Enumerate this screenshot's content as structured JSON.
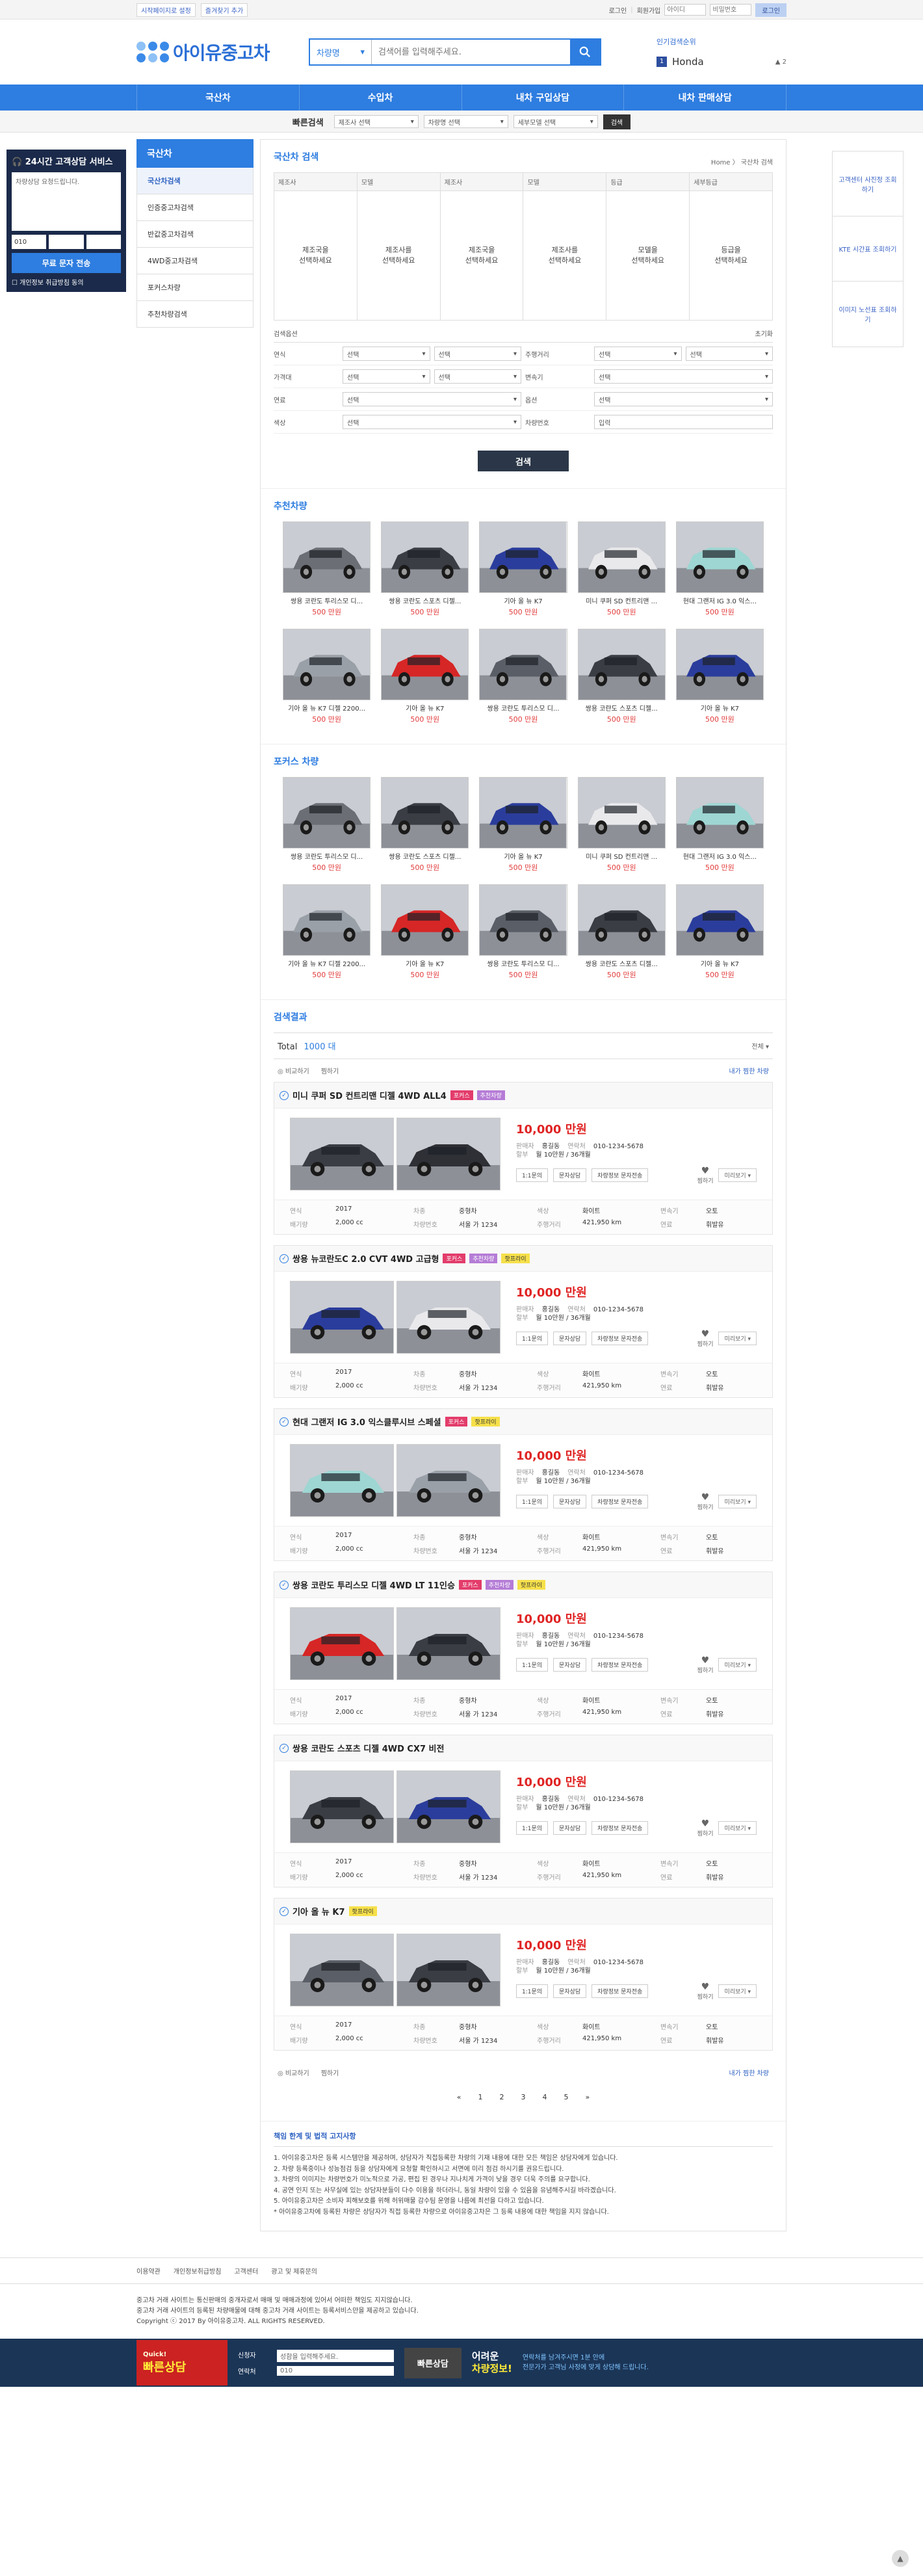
{
  "topbar": {
    "left": [
      "시작페이지로 설정",
      "즐겨찾기 추가"
    ],
    "right": [
      "로그인",
      "회원가입"
    ],
    "id_placeholder": "아이디",
    "pw_placeholder": "비밀번호",
    "login_btn": "로그인"
  },
  "header": {
    "logo": "아이유중고차",
    "search_select": "차량명",
    "search_placeholder": "검색어를 입력해주세요.",
    "rank_title": "인기검색순위",
    "rank_num": "1",
    "rank_value": "Honda",
    "rank_change": "▲ 2"
  },
  "nav": [
    "국산차",
    "수입차",
    "내차 구입상담",
    "내차 판매상담"
  ],
  "quick": {
    "label": "빠른검색",
    "selects": [
      "제조사 선택",
      "차량명 선택",
      "세부모델 선택"
    ],
    "button": "검색"
  },
  "leftcs": {
    "title": "24시간 고객상담 서비스",
    "placeholder": "차량상담 요청드립니다.",
    "phone_prefix": "010",
    "send": "무료 문자 전송",
    "agree": "개인정보 취급방침 동의"
  },
  "rightfloat": [
    "고객센터 사진정 조회하기",
    "KTE 시간표 조회하기",
    "이미지 노선표 조회하기"
  ],
  "sidebar": {
    "title": "국산차",
    "items": [
      "국산차검색",
      "인증중고차검색",
      "반값중고차검색",
      "4WD중고차검색",
      "포커스차량",
      "추천차량검색"
    ]
  },
  "domestic": {
    "title": "국산차 검색",
    "breadcrumb": "Home  〉 국산차 검색",
    "cols": [
      {
        "h": "제조사",
        "b": "제조국을\n선택하세요"
      },
      {
        "h": "모델",
        "b": "제조사를\n선택하세요"
      },
      {
        "h": "제조사",
        "b": "제조국을\n선택하세요"
      },
      {
        "h": "모델",
        "b": "제조사를\n선택하세요"
      },
      {
        "h": "등급",
        "b": "모델을\n선택하세요"
      },
      {
        "h": "세부등급",
        "b": "등급을\n선택하세요"
      }
    ],
    "options_title": "검색옵션",
    "reset": "초기화",
    "rows": [
      {
        "l1": "연식",
        "c1": [
          "선택",
          "선택"
        ],
        "l2": "주행거리",
        "c2": [
          "선택",
          "선택"
        ]
      },
      {
        "l1": "가격대",
        "c1": [
          "선택",
          "선택"
        ],
        "l2": "변속기",
        "c2": [
          "선택"
        ]
      },
      {
        "l1": "연료",
        "c1": [
          "선택"
        ],
        "l2": "옵션",
        "c2": [
          "선택"
        ]
      },
      {
        "l1": "색상",
        "c1": [
          "선택"
        ],
        "l2": "차량번호",
        "c2": [
          "입력"
        ]
      }
    ],
    "search_btn": "검색"
  },
  "recommended": {
    "title": "추천차량",
    "cars": [
      {
        "name": "쌍용 코란도 투리스모 디...",
        "price": "500 만원",
        "color": "#6b6e74"
      },
      {
        "name": "쌍용 코란도 스포츠 디젤...",
        "price": "500 만원",
        "color": "#3a3d44"
      },
      {
        "name": "기아 올 뉴 K7",
        "price": "500 만원",
        "color": "#2b3d9c"
      },
      {
        "name": "미니 쿠퍼 SD 컨트리맨 ...",
        "price": "500 만원",
        "color": "#e9e9ec"
      },
      {
        "name": "현대 그랜저 IG 3.0 익스...",
        "price": "500 만원",
        "color": "#9ed6d3"
      },
      {
        "name": "기아 올 뉴 K7 디젤 2200...",
        "price": "500 만원",
        "color": "#9aa0a8"
      },
      {
        "name": "기아 올 뉴 K7",
        "price": "500 만원",
        "color": "#d62626"
      },
      {
        "name": "쌍용 코란도 투리스모 디...",
        "price": "500 만원",
        "color": "#5a5e66"
      },
      {
        "name": "쌍용 코란도 스포츠 디젤...",
        "price": "500 만원",
        "color": "#3a3d44"
      },
      {
        "name": "기아 올 뉴 K7",
        "price": "500 만원",
        "color": "#2b3d9c"
      }
    ]
  },
  "focus": {
    "title": "포커스 차량",
    "cars": [
      {
        "name": "쌍용 코란도 투리스모 디...",
        "price": "500 만원",
        "color": "#6b6e74"
      },
      {
        "name": "쌍용 코란도 스포츠 디젤...",
        "price": "500 만원",
        "color": "#3a3d44"
      },
      {
        "name": "기아 올 뉴 K7",
        "price": "500 만원",
        "color": "#2b3d9c"
      },
      {
        "name": "미니 쿠퍼 SD 컨트리맨 ...",
        "price": "500 만원",
        "color": "#e9e9ec"
      },
      {
        "name": "현대 그랜저 IG 3.0 익스...",
        "price": "500 만원",
        "color": "#9ed6d3"
      },
      {
        "name": "기아 올 뉴 K7 디젤 2200...",
        "price": "500 만원",
        "color": "#9aa0a8"
      },
      {
        "name": "기아 올 뉴 K7",
        "price": "500 만원",
        "color": "#d62626"
      },
      {
        "name": "쌍용 코란도 투리스모 디...",
        "price": "500 만원",
        "color": "#5a5e66"
      },
      {
        "name": "쌍용 코란도 스포츠 디젤...",
        "price": "500 만원",
        "color": "#3a3d44"
      },
      {
        "name": "기아 올 뉴 K7",
        "price": "500 만원",
        "color": "#2b3d9c"
      }
    ]
  },
  "results": {
    "title": "검색결과",
    "total_label": "Total",
    "total_value": "1000 대",
    "sort": "전체",
    "tools_left": [
      "비교하기",
      "찜하기"
    ],
    "tools_right": "내가 찜한 차량",
    "labels": {
      "seller": "판매자",
      "seller_v": "홍길동",
      "phone": "연락처",
      "phone_v": "010-1234-5678",
      "installment": "할부",
      "installment_v": "월 10만원 / 36개월",
      "act1": "1:1문의",
      "act2": "문자상담",
      "act3": "차량정보 문자전송",
      "heart": "찜하기",
      "more": "미리보기",
      "year": "연식",
      "year_v": "2017",
      "kind": "차종",
      "kind_v": "중형차",
      "color": "색상",
      "color_v": "화이트",
      "trans": "변속기",
      "trans_v": "오토",
      "cc": "배기량",
      "cc_v": "2,000 cc",
      "plate": "차량번호",
      "plate_v": "서울 가 1234",
      "km": "주행거리",
      "km_v": "421,950 km",
      "fuel": "연료",
      "fuel_v": "휘발유"
    },
    "items": [
      {
        "name": "미니 쿠퍼 SD 컨트리맨 디젤 4WD ALL4",
        "badges": [
          "포커스",
          "추천차량"
        ],
        "price": "10,000 만원",
        "c1": "#3a3d44",
        "c2": "#2e3036"
      },
      {
        "name": "쌍용 뉴코란도C 2.0 CVT 4WD 고급형",
        "badges": [
          "포커스",
          "추천차량",
          "핫프라이"
        ],
        "price": "10,000 만원",
        "c1": "#2b3d9c",
        "c2": "#e9e9ec"
      },
      {
        "name": "현대 그랜저 IG 3.0 익스클루시브 스페셜",
        "badges": [
          "포커스",
          "핫프라이"
        ],
        "price": "10,000 만원",
        "c1": "#9ed6d3",
        "c2": "#9aa0a8"
      },
      {
        "name": "쌍용 코란도 투리스모 디젤 4WD LT 11인승",
        "badges": [
          "포커스",
          "추천차량",
          "핫프라이"
        ],
        "price": "10,000 만원",
        "c1": "#d62626",
        "c2": "#3a3d44"
      },
      {
        "name": "쌍용 코란도 스포츠 디젤 4WD CX7 비전",
        "badges": [],
        "price": "10,000 만원",
        "c1": "#3a3d44",
        "c2": "#2b3d9c"
      },
      {
        "name": "기아 올 뉴 K7",
        "badges": [
          "핫프라이"
        ],
        "price": "10,000 만원",
        "c1": "#5a5e66",
        "c2": "#3a3d44"
      }
    ],
    "pager": [
      "«",
      "1",
      "2",
      "3",
      "4",
      "5",
      "»"
    ]
  },
  "notice": {
    "title": "책임 한계 및 법적 고지사항",
    "lines": [
      "1. 아이유중고차은 등록 시스템만을 제공하며, 상담자가 직접등록한 차량의 기재 내용에 대한 모든 책임은 상담자에게 있습니다.",
      "2. 차량 등록중이나 성능점검 등을 상담자에게 요청할 확인하시고 서면에 미리 점검 하시기를 권유드립니다.",
      "3. 차량의 이미지는 차량번호가 미노적으로 가공, 편집 된 경우나 지나치게 가격이 낮을 경우 더욱 주의를 요구합니다.",
      "4. 공연 인지 또는 사무실에 있는 상담자분들이 다수 이용을 하더라니, 동일 차량이 있을 수 있음을 유념해주시길 바라겠습니다.",
      "5. 아이유중고차은 소비자 피해보호를 위해 허위매물 감수팀 운영을 나름에 최선을 다하고 있습니다.",
      "* 아이유중고차에 등록된 차량은 상담자가 직접 등록한 차량으로 아이유중고차은 그 등록 내용에 대한 책임을 지지 않습니다."
    ]
  },
  "footer": {
    "nav": [
      "이용약관",
      "개인정보취급방침",
      "고객센터",
      "광고 및 제휴문의"
    ],
    "info": [
      "중고차 거래 사이트는 통신판매의 중개자로서 매매 및 매매과정에 있어서 어떠한 책임도 지지않습니다.",
      "중고차 거래 사이트의 등록된 차량매물에 대해 중고차 거래 사이트는 등록서비스만을 제공하고 있습니다.",
      "Copyright ⓒ 2017 By 아이유중고차. ALL RIGHTS RESERVED."
    ]
  },
  "banner": {
    "quick": "Quick!",
    "title": "빠른상담",
    "f1": "신청자",
    "f1_v": "성함을 입력해주세요.",
    "f2": "연락처",
    "f2_v": "010",
    "btn": "빠른상담",
    "slogan1": "어려운",
    "slogan2": "차량정보!",
    "desc1": "연락처를 남겨주시면 1분 안에",
    "desc2": "전문가가 고객님 사정에 맞게 상담해 드립니다."
  },
  "top_btn": "▲"
}
